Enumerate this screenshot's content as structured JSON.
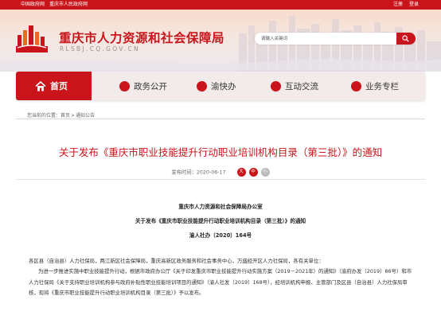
{
  "topbar": {
    "links": [
      "中国政府网",
      "重庆市人民政府网"
    ],
    "login": "注册",
    "register": "登录"
  },
  "header": {
    "title": "重庆市人力资源和社会保障局",
    "url": "RLSBJ.CQ.GOV.CN",
    "search_placeholder": "请输入关键词"
  },
  "nav": {
    "items": [
      {
        "label": "首页",
        "icon": "home-icon"
      },
      {
        "label": "政务公开",
        "icon": "document-icon"
      },
      {
        "label": "渝快办",
        "icon": "service-icon"
      },
      {
        "label": "互动交流",
        "icon": "chat-icon"
      },
      {
        "label": "业务专栏",
        "icon": "column-icon"
      }
    ]
  },
  "breadcrumb": {
    "prefix": "您当前的位置：",
    "items": [
      "首页",
      "通知公告"
    ],
    "sep": ">"
  },
  "article": {
    "title": "关于发布《重庆市职业技能提升行动职业培训机构目录（第三批）》的通知",
    "date_label": "发布时间：2020-06-17",
    "font_sizes": [
      "大",
      "中",
      "小"
    ],
    "issuer": "重庆市人力资源和社会保障局办公室",
    "doc_title": "关于发布《重庆市职业技能提升行动职业培训机构目录（第三批）》的通知",
    "doc_number": "渝人社办〔2020〕164号",
    "recipients": "各区县（自治县）人力社保局，两江新区社会保障局，重庆高新区政务服务和社会事务中心，万盛经开区人力社保局，各有关单位：",
    "body": "为进一步推进实施中职业技能提升行动，根据市政府办公厅《关于印发重庆市职业技能提升行动实施方案（2019－2021年）的通知》（渝府办发〔2019〕86号）和市人力社保局《关于支持职业培训机构参与政府补贴性职业技能培训项目的通知》（渝人社发〔2019〕168号），经培训机构申报、主管部门及区县（自治县）人力社保局审核，现将《重庆市职业技能提升行动职业培训机构目录（第三批）》予以发布。"
  },
  "colors": {
    "brand_red": "#c8141a",
    "nav_bg": "#f3eaea"
  }
}
